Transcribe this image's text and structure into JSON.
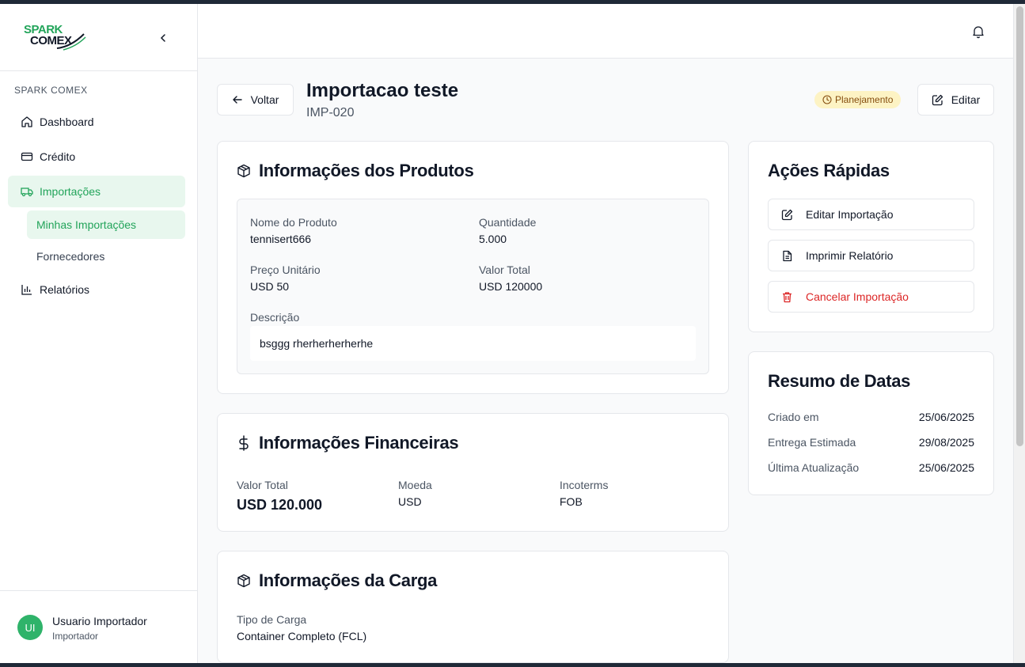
{
  "brand": {
    "line1": "SPARK",
    "line2": "COMEX",
    "primary": "#22a45a"
  },
  "sidebar": {
    "section_title": "SPARK COMEX",
    "items": [
      {
        "label": "Dashboard",
        "icon": "home-icon"
      },
      {
        "label": "Crédito",
        "icon": "credit-card-icon"
      },
      {
        "label": "Importações",
        "icon": "truck-icon"
      },
      {
        "label": "Relatórios",
        "icon": "bar-chart-icon"
      }
    ],
    "subitems": [
      {
        "label": "Minhas Importações"
      },
      {
        "label": "Fornecedores"
      }
    ]
  },
  "user": {
    "initials": "UI",
    "name": "Usuario Importador",
    "role": "Importador"
  },
  "header": {
    "back_label": "Voltar",
    "title": "Importacao teste",
    "code": "IMP-020",
    "status": "Planejamento",
    "edit_label": "Editar"
  },
  "products": {
    "title": "Informações dos Produtos",
    "name_label": "Nome do Produto",
    "name_value": "tennisert666",
    "qty_label": "Quantidade",
    "qty_value": "5.000",
    "unit_price_label": "Preço Unitário",
    "unit_price_value": "USD 50",
    "total_label": "Valor Total",
    "total_value": "USD 120000",
    "desc_label": "Descrição",
    "desc_value": "bsggg rherherherherhe"
  },
  "finance": {
    "title": "Informações Financeiras",
    "total_label": "Valor Total",
    "total_value": "USD 120.000",
    "currency_label": "Moeda",
    "currency_value": "USD",
    "incoterms_label": "Incoterms",
    "incoterms_value": "FOB"
  },
  "cargo": {
    "title": "Informações da Carga",
    "type_label": "Tipo de Carga",
    "type_value": "Container Completo (FCL)"
  },
  "quick_actions": {
    "title": "Ações Rápidas",
    "edit": "Editar Importação",
    "print": "Imprimir Relatório",
    "cancel": "Cancelar Importação"
  },
  "dates": {
    "title": "Resumo de Datas",
    "created_label": "Criado em",
    "created_value": "25/06/2025",
    "delivery_label": "Entrega Estimada",
    "delivery_value": "29/08/2025",
    "updated_label": "Última Atualização",
    "updated_value": "25/06/2025"
  }
}
